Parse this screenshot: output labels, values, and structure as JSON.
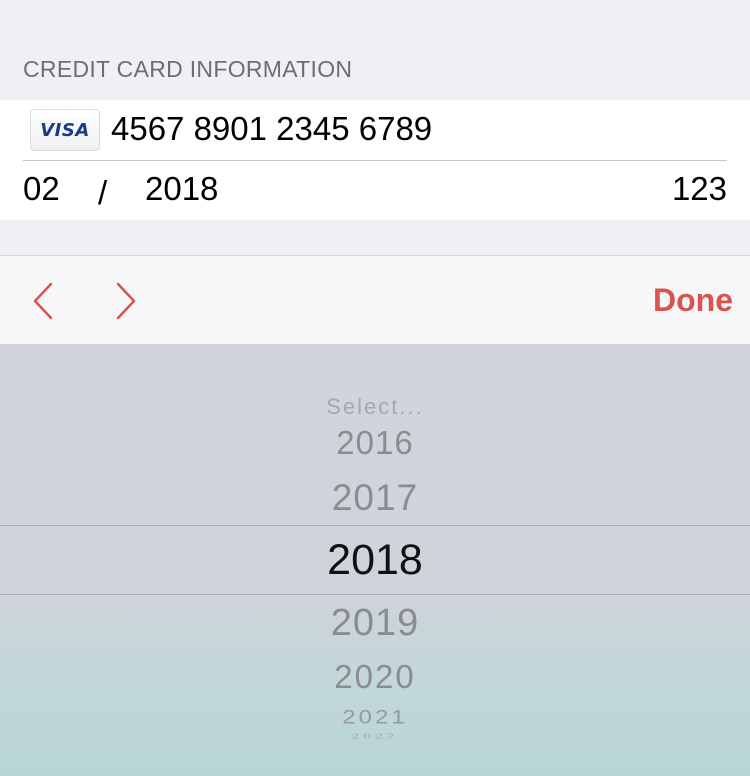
{
  "section": {
    "title": "CREDIT CARD INFORMATION"
  },
  "card": {
    "brand": "VISA",
    "number": "4567 8901 2345 6789",
    "exp_month": "02",
    "exp_separator": "/",
    "exp_year": "2018",
    "cvv": "123"
  },
  "toolbar": {
    "prev_icon": "chevron-left-icon",
    "next_icon": "chevron-right-icon",
    "done_label": "Done",
    "accent_color": "#d9534f"
  },
  "picker": {
    "placeholder": "Select...",
    "items": [
      "2016",
      "2017",
      "2018",
      "2019",
      "2020",
      "2021",
      "2022"
    ],
    "selected": "2018"
  }
}
